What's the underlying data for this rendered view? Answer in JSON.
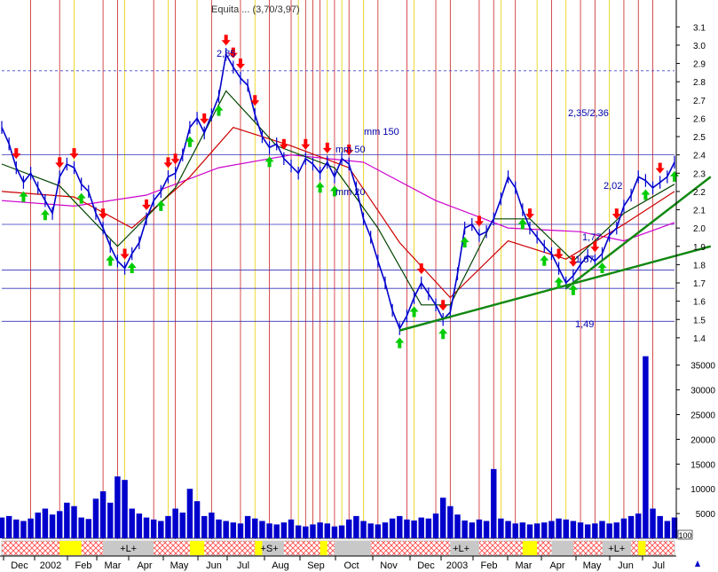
{
  "chart_data": {
    "type": "line",
    "title": "Equita ... (3,70/3,97)",
    "x_ticks": [
      "Dec",
      "2002",
      "Feb",
      "Mar",
      "Apr",
      "May",
      "Jun",
      "Jul",
      "Aug",
      "Sep",
      "Oct",
      "Nov",
      "Dec",
      "2003",
      "Feb",
      "Mar",
      "Apr",
      "May",
      "Jun",
      "Jul"
    ],
    "price_axis": {
      "ylim": [
        1.38,
        3.15
      ],
      "ticks": [
        "3.1",
        "3.0",
        "2.9",
        "2.8",
        "2.7",
        "2.6",
        "2.5",
        "2.4",
        "2.3",
        "2.2",
        "2.1",
        "2.0",
        "1.9",
        "1.8",
        "1.7",
        "1.6",
        "1.5",
        "1.4"
      ]
    },
    "volume_axis": {
      "ylim": [
        0,
        38000
      ],
      "ticks": [
        "35000",
        "30000",
        "25000",
        "20000",
        "15000",
        "10000",
        "5000"
      ],
      "unit_label": "100"
    },
    "price": {
      "name": "price",
      "color": "#0000cc",
      "points": [
        [
          0,
          2.55
        ],
        [
          1,
          2.46
        ],
        [
          2,
          2.33
        ],
        [
          3,
          2.25
        ],
        [
          4,
          2.3
        ],
        [
          5,
          2.22
        ],
        [
          6,
          2.15
        ],
        [
          7,
          2.08
        ],
        [
          8,
          2.28
        ],
        [
          9,
          2.35
        ],
        [
          10,
          2.33
        ],
        [
          11,
          2.24
        ],
        [
          12,
          2.2
        ],
        [
          13,
          2.08
        ],
        [
          14,
          2.0
        ],
        [
          15,
          1.9
        ],
        [
          16,
          1.82
        ],
        [
          17,
          1.78
        ],
        [
          18,
          1.86
        ],
        [
          19,
          1.92
        ],
        [
          20,
          2.05
        ],
        [
          21,
          2.15
        ],
        [
          22,
          2.2
        ],
        [
          23,
          2.28
        ],
        [
          24,
          2.3
        ],
        [
          25,
          2.4
        ],
        [
          26,
          2.55
        ],
        [
          27,
          2.6
        ],
        [
          28,
          2.52
        ],
        [
          29,
          2.62
        ],
        [
          30,
          2.72
        ],
        [
          31,
          2.95
        ],
        [
          32,
          2.88
        ],
        [
          33,
          2.82
        ],
        [
          34,
          2.78
        ],
        [
          35,
          2.62
        ],
        [
          36,
          2.5
        ],
        [
          37,
          2.44
        ],
        [
          38,
          2.46
        ],
        [
          39,
          2.38
        ],
        [
          40,
          2.34
        ],
        [
          41,
          2.3
        ],
        [
          42,
          2.38
        ],
        [
          43,
          2.35
        ],
        [
          44,
          2.3
        ],
        [
          45,
          2.36
        ],
        [
          46,
          2.28
        ],
        [
          47,
          2.38
        ],
        [
          48,
          2.35
        ],
        [
          49,
          2.22
        ],
        [
          50,
          2.05
        ],
        [
          51,
          1.95
        ],
        [
          52,
          1.82
        ],
        [
          53,
          1.7
        ],
        [
          54,
          1.55
        ],
        [
          55,
          1.45
        ],
        [
          56,
          1.52
        ],
        [
          57,
          1.62
        ],
        [
          58,
          1.7
        ],
        [
          59,
          1.64
        ],
        [
          60,
          1.58
        ],
        [
          61,
          1.5
        ],
        [
          62,
          1.54
        ],
        [
          63,
          1.75
        ],
        [
          64,
          2.0
        ],
        [
          65,
          2.02
        ],
        [
          66,
          1.96
        ],
        [
          67,
          1.98
        ],
        [
          68,
          2.05
        ],
        [
          69,
          2.16
        ],
        [
          70,
          2.28
        ],
        [
          71,
          2.22
        ],
        [
          72,
          2.1
        ],
        [
          73,
          2.0
        ],
        [
          74,
          1.95
        ],
        [
          75,
          1.9
        ],
        [
          76,
          1.86
        ],
        [
          77,
          1.78
        ],
        [
          78,
          1.7
        ],
        [
          79,
          1.74
        ],
        [
          80,
          1.8
        ],
        [
          81,
          1.85
        ],
        [
          82,
          1.82
        ],
        [
          83,
          1.86
        ],
        [
          84,
          1.96
        ],
        [
          85,
          2.0
        ],
        [
          86,
          2.12
        ],
        [
          87,
          2.18
        ],
        [
          88,
          2.28
        ],
        [
          89,
          2.26
        ],
        [
          90,
          2.22
        ],
        [
          91,
          2.25
        ],
        [
          92,
          2.28
        ],
        [
          93,
          2.36
        ]
      ]
    },
    "moving_averages": [
      {
        "name": "mm 150",
        "color": "#cc00cc",
        "points": [
          [
            0,
            2.15
          ],
          [
            10,
            2.12
          ],
          [
            20,
            2.18
          ],
          [
            30,
            2.33
          ],
          [
            40,
            2.4
          ],
          [
            50,
            2.36
          ],
          [
            60,
            2.15
          ],
          [
            70,
            2.0
          ],
          [
            80,
            1.98
          ],
          [
            86,
            1.93
          ],
          [
            93,
            2.03
          ]
        ]
      },
      {
        "name": "mm 50",
        "color": "#cc0000",
        "points": [
          [
            0,
            2.2
          ],
          [
            10,
            2.17
          ],
          [
            18,
            2.0
          ],
          [
            26,
            2.28
          ],
          [
            32,
            2.55
          ],
          [
            40,
            2.45
          ],
          [
            48,
            2.33
          ],
          [
            55,
            1.92
          ],
          [
            62,
            1.62
          ],
          [
            70,
            1.93
          ],
          [
            78,
            1.83
          ],
          [
            86,
            2.02
          ],
          [
            93,
            2.2
          ]
        ]
      },
      {
        "name": "mm 20",
        "color": "#004400",
        "points": [
          [
            0,
            2.35
          ],
          [
            8,
            2.23
          ],
          [
            16,
            1.9
          ],
          [
            24,
            2.22
          ],
          [
            31,
            2.75
          ],
          [
            38,
            2.45
          ],
          [
            46,
            2.33
          ],
          [
            52,
            2.0
          ],
          [
            58,
            1.58
          ],
          [
            62,
            1.58
          ],
          [
            68,
            2.05
          ],
          [
            73,
            2.05
          ],
          [
            79,
            1.82
          ],
          [
            86,
            2.08
          ],
          [
            93,
            2.24
          ]
        ]
      }
    ],
    "horizontal_levels": [
      {
        "value": 2.4,
        "label": "2,35/2,36"
      },
      {
        "value": 2.02,
        "label": "2,02"
      },
      {
        "value": 1.77,
        "label": "1,77"
      },
      {
        "value": 1.67,
        "label": "1,67"
      },
      {
        "value": 1.49,
        "label": "1,49"
      },
      {
        "value": 2.86,
        "label": ""
      }
    ],
    "annotations": [
      "2,85",
      "2,35/2,36",
      "mm 150",
      "mm 50",
      "mm 20",
      "2,02",
      "1,77",
      "1,67",
      "1,49"
    ],
    "trendlines": [
      {
        "color": "#118811",
        "from": [
          55,
          1.44
        ],
        "to": [
          98,
          1.9
        ]
      },
      {
        "color": "#118811",
        "from": [
          78,
          1.67
        ],
        "to": [
          98,
          2.28
        ]
      }
    ],
    "sell_arrows": [
      2,
      8,
      10,
      14,
      17,
      20,
      23,
      24,
      28,
      31,
      32,
      33,
      35,
      39,
      42,
      45,
      48,
      58,
      61,
      66,
      73,
      77,
      79,
      82,
      85,
      91
    ],
    "buy_arrows": [
      3,
      6,
      11,
      15,
      18,
      22,
      26,
      30,
      37,
      44,
      46,
      55,
      57,
      61,
      64,
      72,
      75,
      77,
      79,
      83,
      89,
      93
    ],
    "volume": {
      "color": "#0000cc",
      "values": [
        4200,
        4500,
        3800,
        3500,
        4000,
        5200,
        6000,
        4800,
        5500,
        7200,
        6500,
        4200,
        3900,
        8000,
        9500,
        7200,
        12500,
        11800,
        6000,
        5000,
        4200,
        3800,
        3500,
        4500,
        6000,
        5200,
        10000,
        7500,
        4500,
        5200,
        3800,
        3500,
        3200,
        3000,
        4500,
        4000,
        3500,
        3000,
        2800,
        3200,
        3800,
        2600,
        2400,
        2800,
        3200,
        3000,
        2400,
        2600,
        3800,
        4500,
        3500,
        3000,
        2800,
        3200,
        4000,
        4500,
        3800,
        3600,
        4200,
        4000,
        5000,
        8200,
        6500,
        4800,
        3600,
        3200,
        3800,
        3500,
        14000,
        4000,
        3500,
        3000,
        3200,
        2800,
        3000,
        3200,
        3500,
        4000,
        3800,
        3500,
        3200,
        2800,
        3000,
        3500,
        3000,
        3200,
        4000,
        4500,
        5000,
        36800,
        6000,
        4500,
        3500,
        4200
      ]
    },
    "event_strip_labels": [
      "+L+",
      "+S+",
      "+L+",
      "+L+"
    ]
  }
}
